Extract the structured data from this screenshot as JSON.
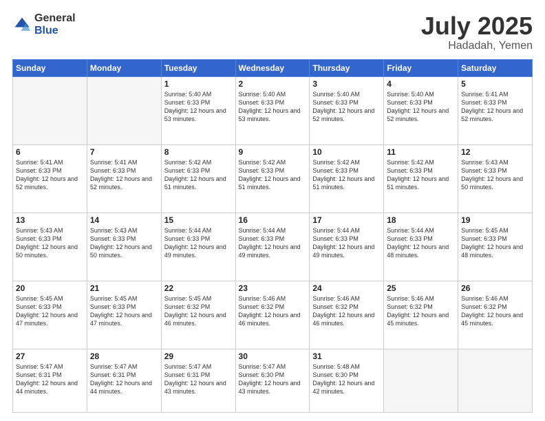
{
  "logo": {
    "general": "General",
    "blue": "Blue"
  },
  "title": {
    "month": "July 2025",
    "location": "Hadadah, Yemen"
  },
  "weekdays": [
    "Sunday",
    "Monday",
    "Tuesday",
    "Wednesday",
    "Thursday",
    "Friday",
    "Saturday"
  ],
  "weeks": [
    [
      {
        "day": "",
        "info": ""
      },
      {
        "day": "",
        "info": ""
      },
      {
        "day": "1",
        "info": "Sunrise: 5:40 AM\nSunset: 6:33 PM\nDaylight: 12 hours and 53 minutes."
      },
      {
        "day": "2",
        "info": "Sunrise: 5:40 AM\nSunset: 6:33 PM\nDaylight: 12 hours and 53 minutes."
      },
      {
        "day": "3",
        "info": "Sunrise: 5:40 AM\nSunset: 6:33 PM\nDaylight: 12 hours and 52 minutes."
      },
      {
        "day": "4",
        "info": "Sunrise: 5:40 AM\nSunset: 6:33 PM\nDaylight: 12 hours and 52 minutes."
      },
      {
        "day": "5",
        "info": "Sunrise: 5:41 AM\nSunset: 6:33 PM\nDaylight: 12 hours and 52 minutes."
      }
    ],
    [
      {
        "day": "6",
        "info": "Sunrise: 5:41 AM\nSunset: 6:33 PM\nDaylight: 12 hours and 52 minutes."
      },
      {
        "day": "7",
        "info": "Sunrise: 5:41 AM\nSunset: 6:33 PM\nDaylight: 12 hours and 52 minutes."
      },
      {
        "day": "8",
        "info": "Sunrise: 5:42 AM\nSunset: 6:33 PM\nDaylight: 12 hours and 51 minutes."
      },
      {
        "day": "9",
        "info": "Sunrise: 5:42 AM\nSunset: 6:33 PM\nDaylight: 12 hours and 51 minutes."
      },
      {
        "day": "10",
        "info": "Sunrise: 5:42 AM\nSunset: 6:33 PM\nDaylight: 12 hours and 51 minutes."
      },
      {
        "day": "11",
        "info": "Sunrise: 5:42 AM\nSunset: 6:33 PM\nDaylight: 12 hours and 51 minutes."
      },
      {
        "day": "12",
        "info": "Sunrise: 5:43 AM\nSunset: 6:33 PM\nDaylight: 12 hours and 50 minutes."
      }
    ],
    [
      {
        "day": "13",
        "info": "Sunrise: 5:43 AM\nSunset: 6:33 PM\nDaylight: 12 hours and 50 minutes."
      },
      {
        "day": "14",
        "info": "Sunrise: 5:43 AM\nSunset: 6:33 PM\nDaylight: 12 hours and 50 minutes."
      },
      {
        "day": "15",
        "info": "Sunrise: 5:44 AM\nSunset: 6:33 PM\nDaylight: 12 hours and 49 minutes."
      },
      {
        "day": "16",
        "info": "Sunrise: 5:44 AM\nSunset: 6:33 PM\nDaylight: 12 hours and 49 minutes."
      },
      {
        "day": "17",
        "info": "Sunrise: 5:44 AM\nSunset: 6:33 PM\nDaylight: 12 hours and 49 minutes."
      },
      {
        "day": "18",
        "info": "Sunrise: 5:44 AM\nSunset: 6:33 PM\nDaylight: 12 hours and 48 minutes."
      },
      {
        "day": "19",
        "info": "Sunrise: 5:45 AM\nSunset: 6:33 PM\nDaylight: 12 hours and 48 minutes."
      }
    ],
    [
      {
        "day": "20",
        "info": "Sunrise: 5:45 AM\nSunset: 6:33 PM\nDaylight: 12 hours and 47 minutes."
      },
      {
        "day": "21",
        "info": "Sunrise: 5:45 AM\nSunset: 6:33 PM\nDaylight: 12 hours and 47 minutes."
      },
      {
        "day": "22",
        "info": "Sunrise: 5:45 AM\nSunset: 6:32 PM\nDaylight: 12 hours and 46 minutes."
      },
      {
        "day": "23",
        "info": "Sunrise: 5:46 AM\nSunset: 6:32 PM\nDaylight: 12 hours and 46 minutes."
      },
      {
        "day": "24",
        "info": "Sunrise: 5:46 AM\nSunset: 6:32 PM\nDaylight: 12 hours and 46 minutes."
      },
      {
        "day": "25",
        "info": "Sunrise: 5:46 AM\nSunset: 6:32 PM\nDaylight: 12 hours and 45 minutes."
      },
      {
        "day": "26",
        "info": "Sunrise: 5:46 AM\nSunset: 6:32 PM\nDaylight: 12 hours and 45 minutes."
      }
    ],
    [
      {
        "day": "27",
        "info": "Sunrise: 5:47 AM\nSunset: 6:31 PM\nDaylight: 12 hours and 44 minutes."
      },
      {
        "day": "28",
        "info": "Sunrise: 5:47 AM\nSunset: 6:31 PM\nDaylight: 12 hours and 44 minutes."
      },
      {
        "day": "29",
        "info": "Sunrise: 5:47 AM\nSunset: 6:31 PM\nDaylight: 12 hours and 43 minutes."
      },
      {
        "day": "30",
        "info": "Sunrise: 5:47 AM\nSunset: 6:30 PM\nDaylight: 12 hours and 43 minutes."
      },
      {
        "day": "31",
        "info": "Sunrise: 5:48 AM\nSunset: 6:30 PM\nDaylight: 12 hours and 42 minutes."
      },
      {
        "day": "",
        "info": ""
      },
      {
        "day": "",
        "info": ""
      }
    ]
  ]
}
